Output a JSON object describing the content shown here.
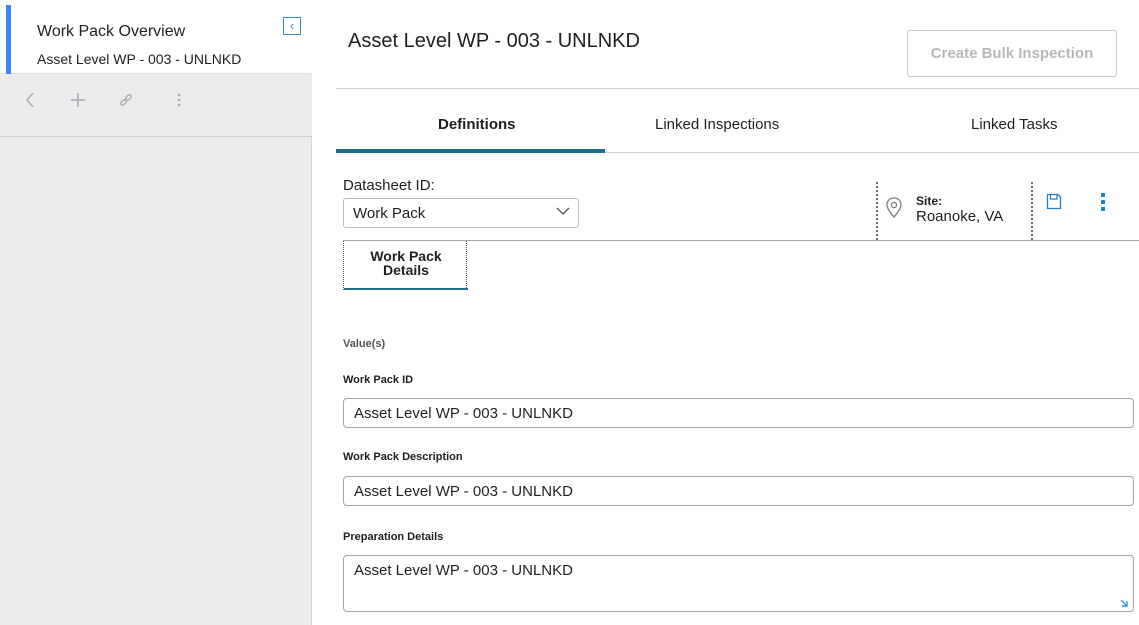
{
  "sidebar": {
    "title": "Work Pack Overview",
    "subtitle": "Asset Level WP - 003 - UNLNKD",
    "toolbar": {
      "back_icon": "chevron-left-icon",
      "add_icon": "plus-icon",
      "link_icon": "link-icon",
      "more_icon": "more-vertical-icon"
    }
  },
  "header": {
    "title": "Asset Level WP - 003 - UNLNKD",
    "bulk_button": "Create Bulk Inspection"
  },
  "tabs": [
    {
      "label": "Definitions",
      "active": true
    },
    {
      "label": "Linked Inspections",
      "active": false
    },
    {
      "label": "Linked Tasks",
      "active": false
    }
  ],
  "datasheet": {
    "label": "Datasheet ID:",
    "selected": "Work Pack"
  },
  "site": {
    "label": "Site:",
    "value": "Roanoke, VA"
  },
  "subtab": {
    "label_line1": "Work Pack",
    "label_line2": "Details"
  },
  "form": {
    "values_heading": "Value(s)",
    "fields": [
      {
        "label": "Work Pack ID",
        "value": "Asset Level WP - 003 - UNLNKD"
      },
      {
        "label": "Work Pack Description",
        "value": "Asset Level WP - 003 - UNLNKD"
      },
      {
        "label": "Preparation Details",
        "value": "Asset Level WP - 003 - UNLNKD"
      }
    ]
  },
  "colors": {
    "accent_blue": "#3b82f6",
    "tab_underline": "#1b6f8c",
    "icon_blue": "#1b7fd0"
  }
}
